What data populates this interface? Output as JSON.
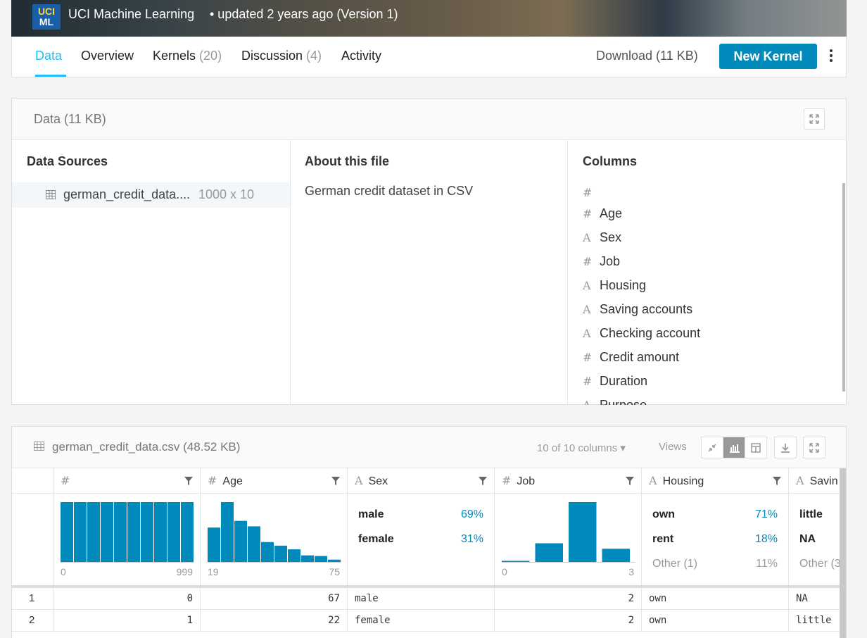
{
  "banner": {
    "logo_line1": "UCI",
    "logo_line2": "ML",
    "owner": "UCI Machine Learning",
    "updated": "• updated 2 years ago (Version 1)"
  },
  "tabs": [
    {
      "label": "Data",
      "count": ""
    },
    {
      "label": "Overview",
      "count": ""
    },
    {
      "label": "Kernels",
      "count": "(20)"
    },
    {
      "label": "Discussion",
      "count": "(4)"
    },
    {
      "label": "Activity",
      "count": ""
    }
  ],
  "actions": {
    "download": "Download (11 KB)",
    "new_kernel": "New Kernel"
  },
  "data_panel": {
    "title": "Data (11 KB)",
    "sources_heading": "Data Sources",
    "source_name": "german_credit_data....",
    "source_dims": "1000 x 10",
    "about_heading": "About this file",
    "about_text": "German credit dataset in CSV",
    "columns_heading": "Columns",
    "columns": [
      {
        "type": "#",
        "name": ""
      },
      {
        "type": "#",
        "name": "Age"
      },
      {
        "type": "A",
        "name": "Sex"
      },
      {
        "type": "#",
        "name": "Job"
      },
      {
        "type": "A",
        "name": "Housing"
      },
      {
        "type": "A",
        "name": "Saving accounts"
      },
      {
        "type": "A",
        "name": "Checking account"
      },
      {
        "type": "#",
        "name": "Credit amount"
      },
      {
        "type": "#",
        "name": "Duration"
      },
      {
        "type": "A",
        "name": "Purpose"
      }
    ]
  },
  "file_panel": {
    "title": "german_credit_data.csv (48.52 KB)",
    "column_count": "10 of 10 columns",
    "views_label": "Views",
    "headers": [
      {
        "type": "#",
        "name": ""
      },
      {
        "type": "#",
        "name": "Age"
      },
      {
        "type": "A",
        "name": "Sex"
      },
      {
        "type": "#",
        "name": "Job"
      },
      {
        "type": "A",
        "name": "Housing"
      },
      {
        "type": "A",
        "name": "Savin"
      }
    ],
    "summary": {
      "index_axis": [
        "0",
        "999"
      ],
      "age_axis": [
        "19",
        "75"
      ],
      "job_axis": [
        "0",
        "3"
      ],
      "sex": [
        {
          "label": "male",
          "pct": "69%"
        },
        {
          "label": "female",
          "pct": "31%"
        }
      ],
      "housing": [
        {
          "label": "own",
          "pct": "71%"
        },
        {
          "label": "rent",
          "pct": "18%"
        },
        {
          "label": "Other (1)",
          "pct": "11%"
        }
      ],
      "saving": [
        {
          "label": "little"
        },
        {
          "label": "NA"
        },
        {
          "label": "Other (3"
        }
      ]
    },
    "rows": [
      {
        "row": "1",
        "idx": "0",
        "age": "67",
        "sex": "male",
        "job": "2",
        "housing": "own",
        "saving": "NA"
      },
      {
        "row": "2",
        "idx": "1",
        "age": "22",
        "sex": "female",
        "job": "2",
        "housing": "own",
        "saving": "little"
      }
    ]
  },
  "chart_data": [
    {
      "type": "bar",
      "title": "",
      "categories": [
        "1",
        "2",
        "3",
        "4",
        "5",
        "6",
        "7",
        "8",
        "9",
        "10"
      ],
      "values": [
        100,
        100,
        100,
        100,
        100,
        100,
        100,
        100,
        100,
        100
      ]
    },
    {
      "type": "bar",
      "title": "",
      "categories": [
        "1",
        "2",
        "3",
        "4",
        "5",
        "6",
        "7",
        "8",
        "9",
        "10"
      ],
      "values": [
        58,
        100,
        69,
        60,
        34,
        28,
        22,
        12,
        11,
        5
      ]
    },
    {
      "type": "bar",
      "title": "",
      "categories": [
        "0",
        "1",
        "2",
        "3"
      ],
      "values": [
        3,
        32,
        100,
        23
      ]
    }
  ],
  "colors": {
    "accent": "#20beff",
    "bar": "#008abc"
  }
}
